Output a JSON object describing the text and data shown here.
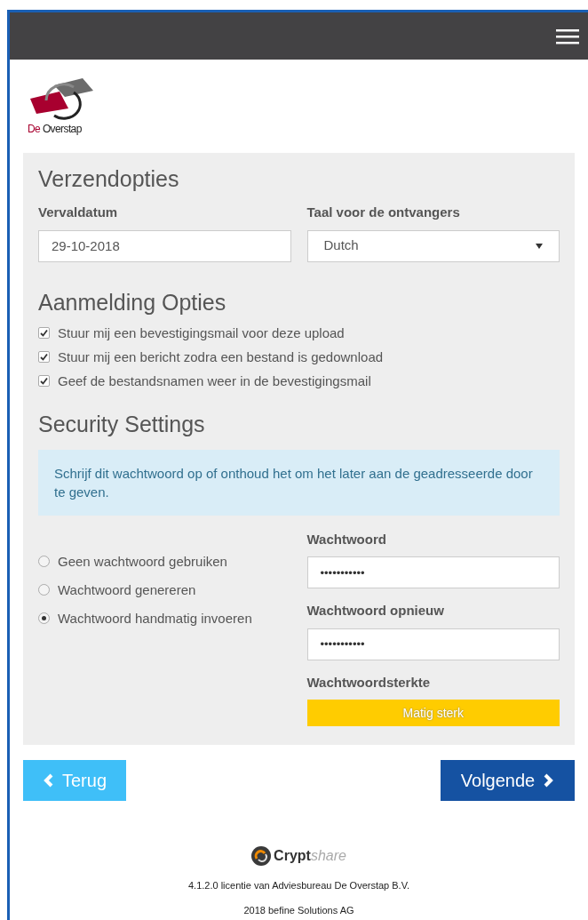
{
  "logo": {
    "part_1": "De",
    "part_2": "Overstap"
  },
  "send_options": {
    "title": "Verzendopties",
    "expiry": {
      "label": "Vervaldatum",
      "value": "29-10-2018"
    },
    "language": {
      "label": "Taal voor de ontvangers",
      "value": "Dutch"
    }
  },
  "notification_options": {
    "title": "Aanmelding Opties",
    "items": [
      {
        "label": "Stuur mij een bevestigingsmail voor deze upload",
        "checked": true
      },
      {
        "label": "Stuur mij een bericht zodra een bestand is gedownload",
        "checked": true
      },
      {
        "label": "Geef de bestandsnamen weer in de bevestigingsmail",
        "checked": true
      }
    ]
  },
  "security": {
    "title": "Security Settings",
    "info": "Schrijf dit wachtwoord op of onthoud het om het later aan de geadresseerde door te geven.",
    "modes": [
      {
        "label": "Geen wachtwoord gebruiken",
        "selected": false
      },
      {
        "label": "Wachtwoord genereren",
        "selected": false
      },
      {
        "label": "Wachtwoord handmatig invoeren",
        "selected": true
      }
    ],
    "password": {
      "label": "Wachtwoord",
      "value": "•••••••••••"
    },
    "password_repeat": {
      "label": "Wachtwoord opnieuw",
      "value": "•••••••••••"
    },
    "strength": {
      "label": "Wachtwoordsterkte",
      "reading": "Matig sterk",
      "level": 1
    }
  },
  "buttons": {
    "back": "Terug",
    "next": "Volgende"
  },
  "footer": {
    "brand_bold": "Crypt",
    "brand_light": "share",
    "license": "4.1.2.0 licentie van Adviesbureau De Overstap B.V.",
    "copyright": "2018 befine Solutions AG"
  }
}
